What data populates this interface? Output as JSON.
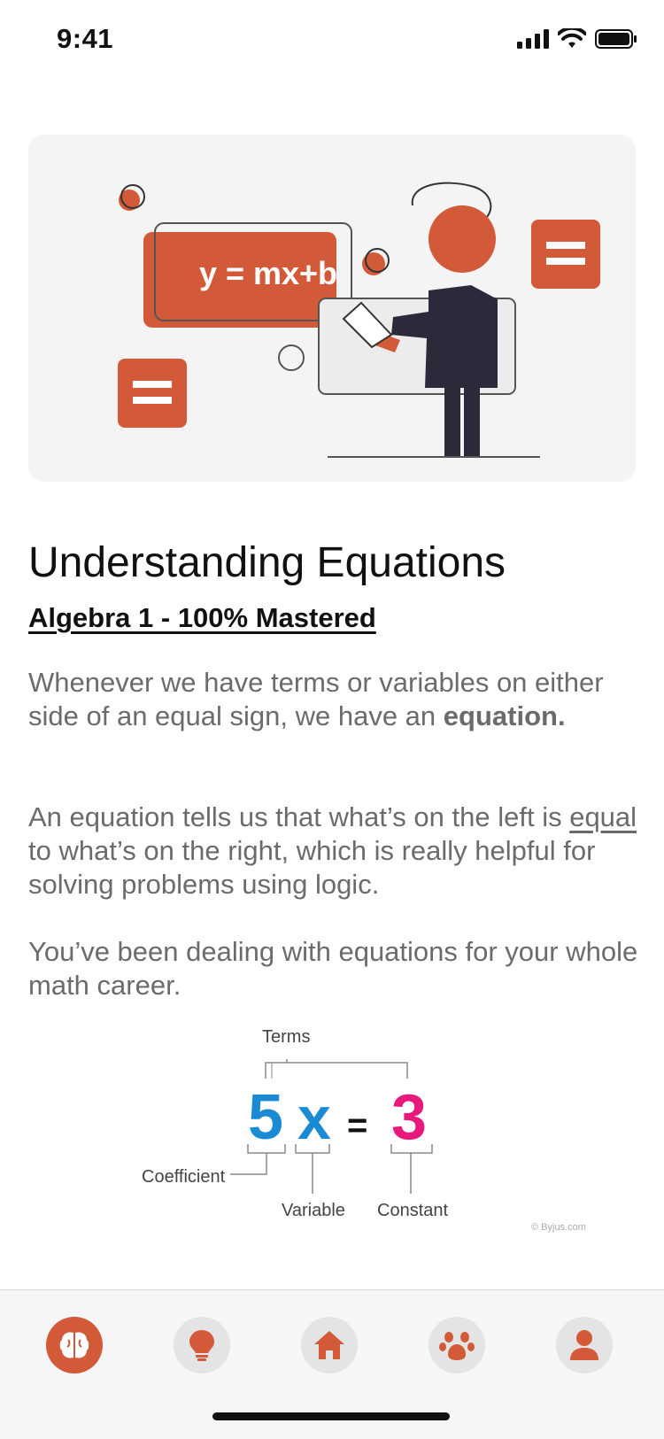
{
  "status_bar": {
    "time": "9:41"
  },
  "hero": {
    "equation_text": "y = mx+b",
    "accent_color": "#d35a38"
  },
  "lesson": {
    "title": "Understanding Equations",
    "subtitle": "Algebra 1 - 100% Mastered",
    "p1_text": "Whenever we have terms or variables on either side of an equal sign, we have an ",
    "p1_bold": "equation.",
    "p2_underlined": "equal",
    "p2_text": " to what’s on the right, which is really helpful for solving problems using logic.",
    "p2_lead": "An equation tells us that what’s on the left is ",
    "p3_text": "You’ve been dealing with equations for your whole math career."
  },
  "diagram": {
    "terms_label": "Terms",
    "coefficient_value": "5",
    "variable_value": "x",
    "equals_sign": "=",
    "constant_value": "3",
    "coefficient_label": "Coefficient",
    "variable_label": "Variable",
    "constant_label": "Constant",
    "credit": "© Byjus.com",
    "coefficient_color": "#1a8ad4",
    "constant_color": "#e8197d"
  },
  "bottom_nav": {
    "items": [
      {
        "icon": "brain-icon",
        "active": true
      },
      {
        "icon": "lightbulb-icon",
        "active": false
      },
      {
        "icon": "home-icon",
        "active": false
      },
      {
        "icon": "paw-icon",
        "active": false
      },
      {
        "icon": "user-icon",
        "active": false
      }
    ]
  }
}
